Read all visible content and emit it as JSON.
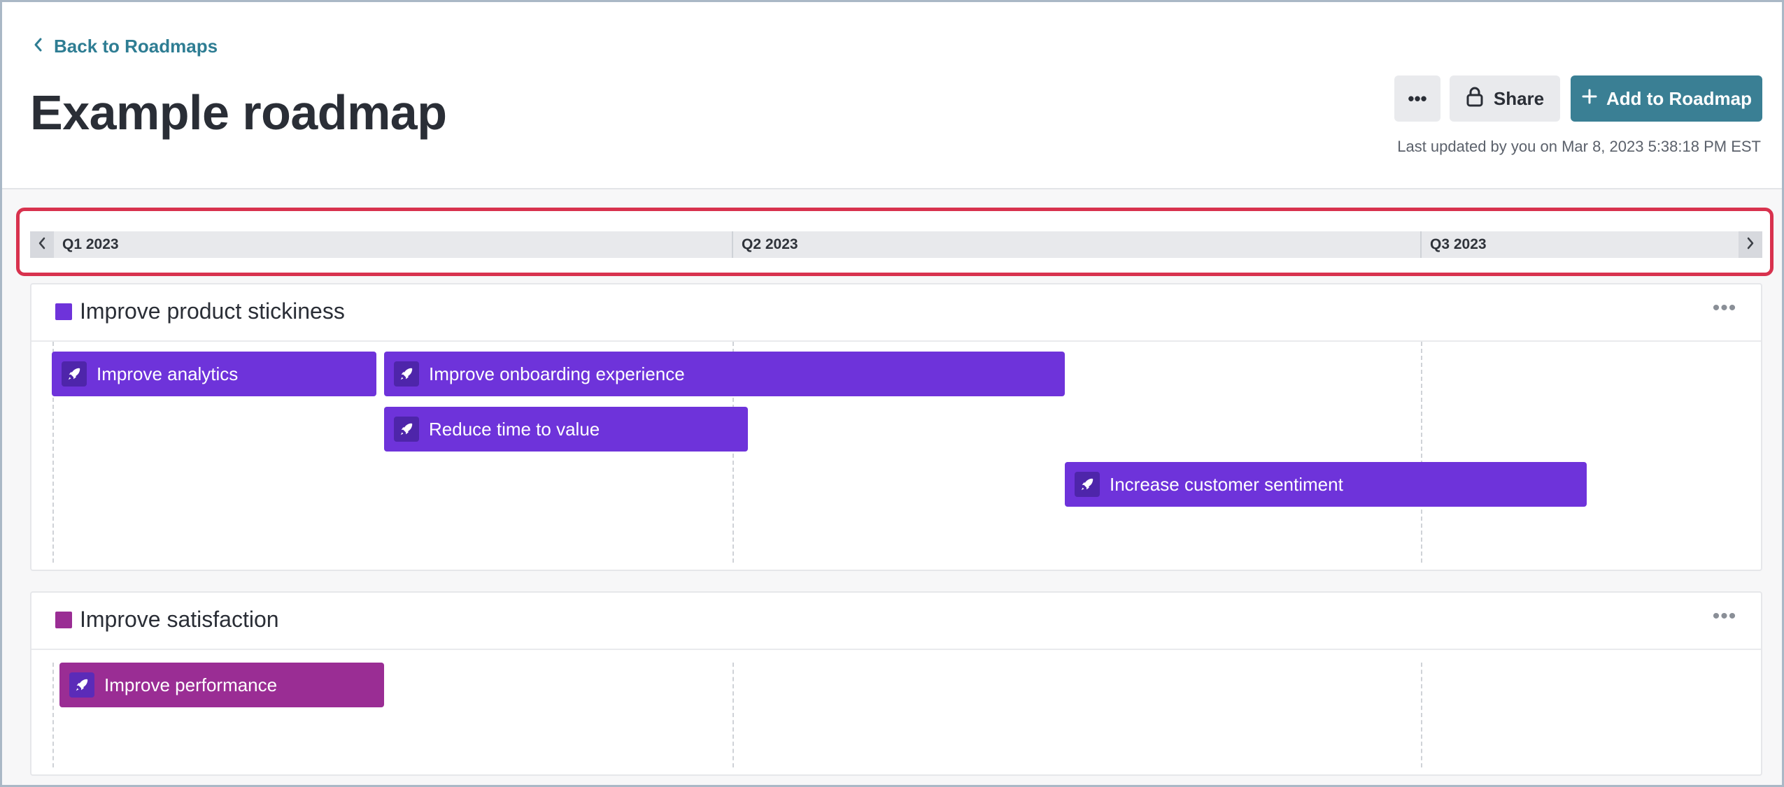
{
  "header": {
    "back_label": "Back to Roadmaps",
    "title": "Example roadmap",
    "more_label": "•••",
    "share_label": "Share",
    "add_label": "Add to Roadmap",
    "last_updated": "Last updated by you on Mar 8, 2023 5:38:18 PM EST"
  },
  "timeline": {
    "quarters": [
      "Q1 2023",
      "Q2 2023",
      "Q3 2023"
    ]
  },
  "lanes": [
    {
      "title": "Improve product stickiness",
      "color": "#6e33da",
      "menu_label": "•••",
      "items": [
        "Improve analytics",
        "Improve onboarding experience",
        "Reduce time to value",
        "Increase customer sentiment"
      ]
    },
    {
      "title": "Improve satisfaction",
      "color": "#9a2d94",
      "menu_label": "•••",
      "items": [
        "Improve performance"
      ]
    }
  ],
  "icons": {
    "back": "chevron-left-icon",
    "share": "lock-icon",
    "add": "plus-icon",
    "bar": "rocket-icon"
  },
  "colors": {
    "accent": "#3a7f94",
    "highlight_frame": "#d8324e",
    "lane1_bar": "#6e33da",
    "lane2_bar": "#9a2d94"
  }
}
